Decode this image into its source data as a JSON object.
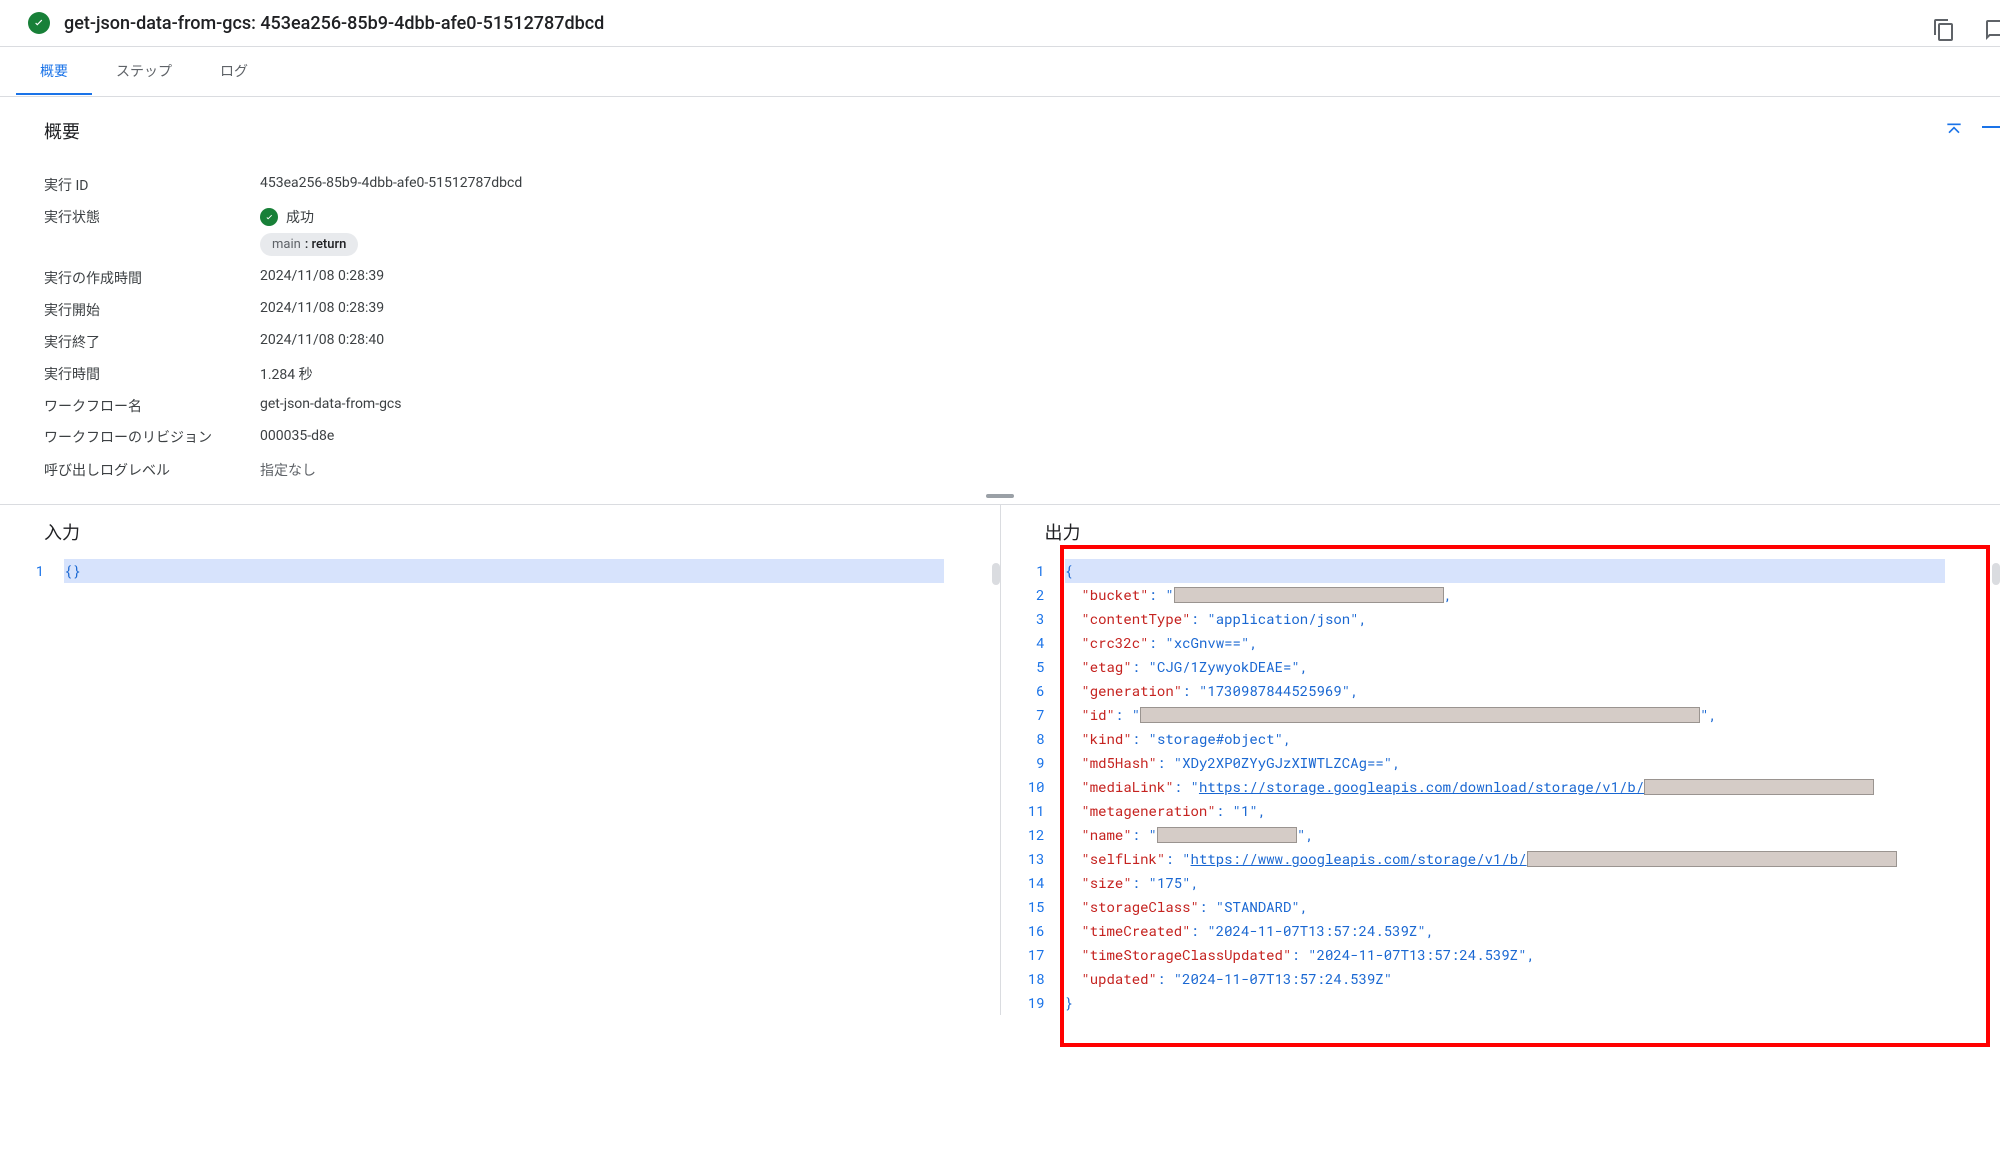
{
  "header": {
    "title": "get-json-data-from-gcs: 453ea256-85b9-4dbb-afe0-51512787dbcd"
  },
  "tabs": {
    "overview": "概要",
    "steps": "ステップ",
    "logs": "ログ"
  },
  "section_overview_title": "概要",
  "details": {
    "execution_id_label": "実行 ID",
    "execution_id": "453ea256-85b9-4dbb-afe0-51512787dbcd",
    "state_label": "実行状態",
    "state_value": "成功",
    "pill_main": "main",
    "pill_sub": ": return",
    "created_label": "実行の作成時間",
    "created_value": "2024/11/08 0:28:39",
    "started_label": "実行開始",
    "started_value": "2024/11/08 0:28:39",
    "ended_label": "実行終了",
    "ended_value": "2024/11/08 0:28:40",
    "duration_label": "実行時間",
    "duration_value": "1.284 秒",
    "workflow_name_label": "ワークフロー名",
    "workflow_name_value": "get-json-data-from-gcs",
    "revision_label": "ワークフローのリビジョン",
    "revision_value": "000035-d8e",
    "loglevel_label": "呼び出しログレベル",
    "loglevel_value": "指定なし"
  },
  "io": {
    "input_title": "入力",
    "output_title": "出力",
    "input_body": "{}"
  },
  "output_json": {
    "bucket_redacted": true,
    "contentType": "application/json",
    "crc32c": "xcGnvw==",
    "etag": "CJG/1ZywyokDEAE=",
    "generation": "1730987844525969",
    "id_redacted": true,
    "kind": "storage#object",
    "md5Hash": "XDy2XP0ZYyGJzXIWTLZCAg==",
    "mediaLink_prefix": "https://storage.googleapis.com/download/storage/v1/b/",
    "mediaLink_redacted_suffix": true,
    "metageneration": "1",
    "name_redacted": true,
    "selfLink_prefix": "https://www.googleapis.com/storage/v1/b/",
    "selfLink_redacted_suffix": true,
    "size": "175",
    "storageClass": "STANDARD",
    "timeCreated": "2024-11-07T13:57:24.539Z",
    "timeStorageClassUpdated": "2024-11-07T13:57:24.539Z",
    "updated": "2024-11-07T13:57:24.539Z"
  }
}
